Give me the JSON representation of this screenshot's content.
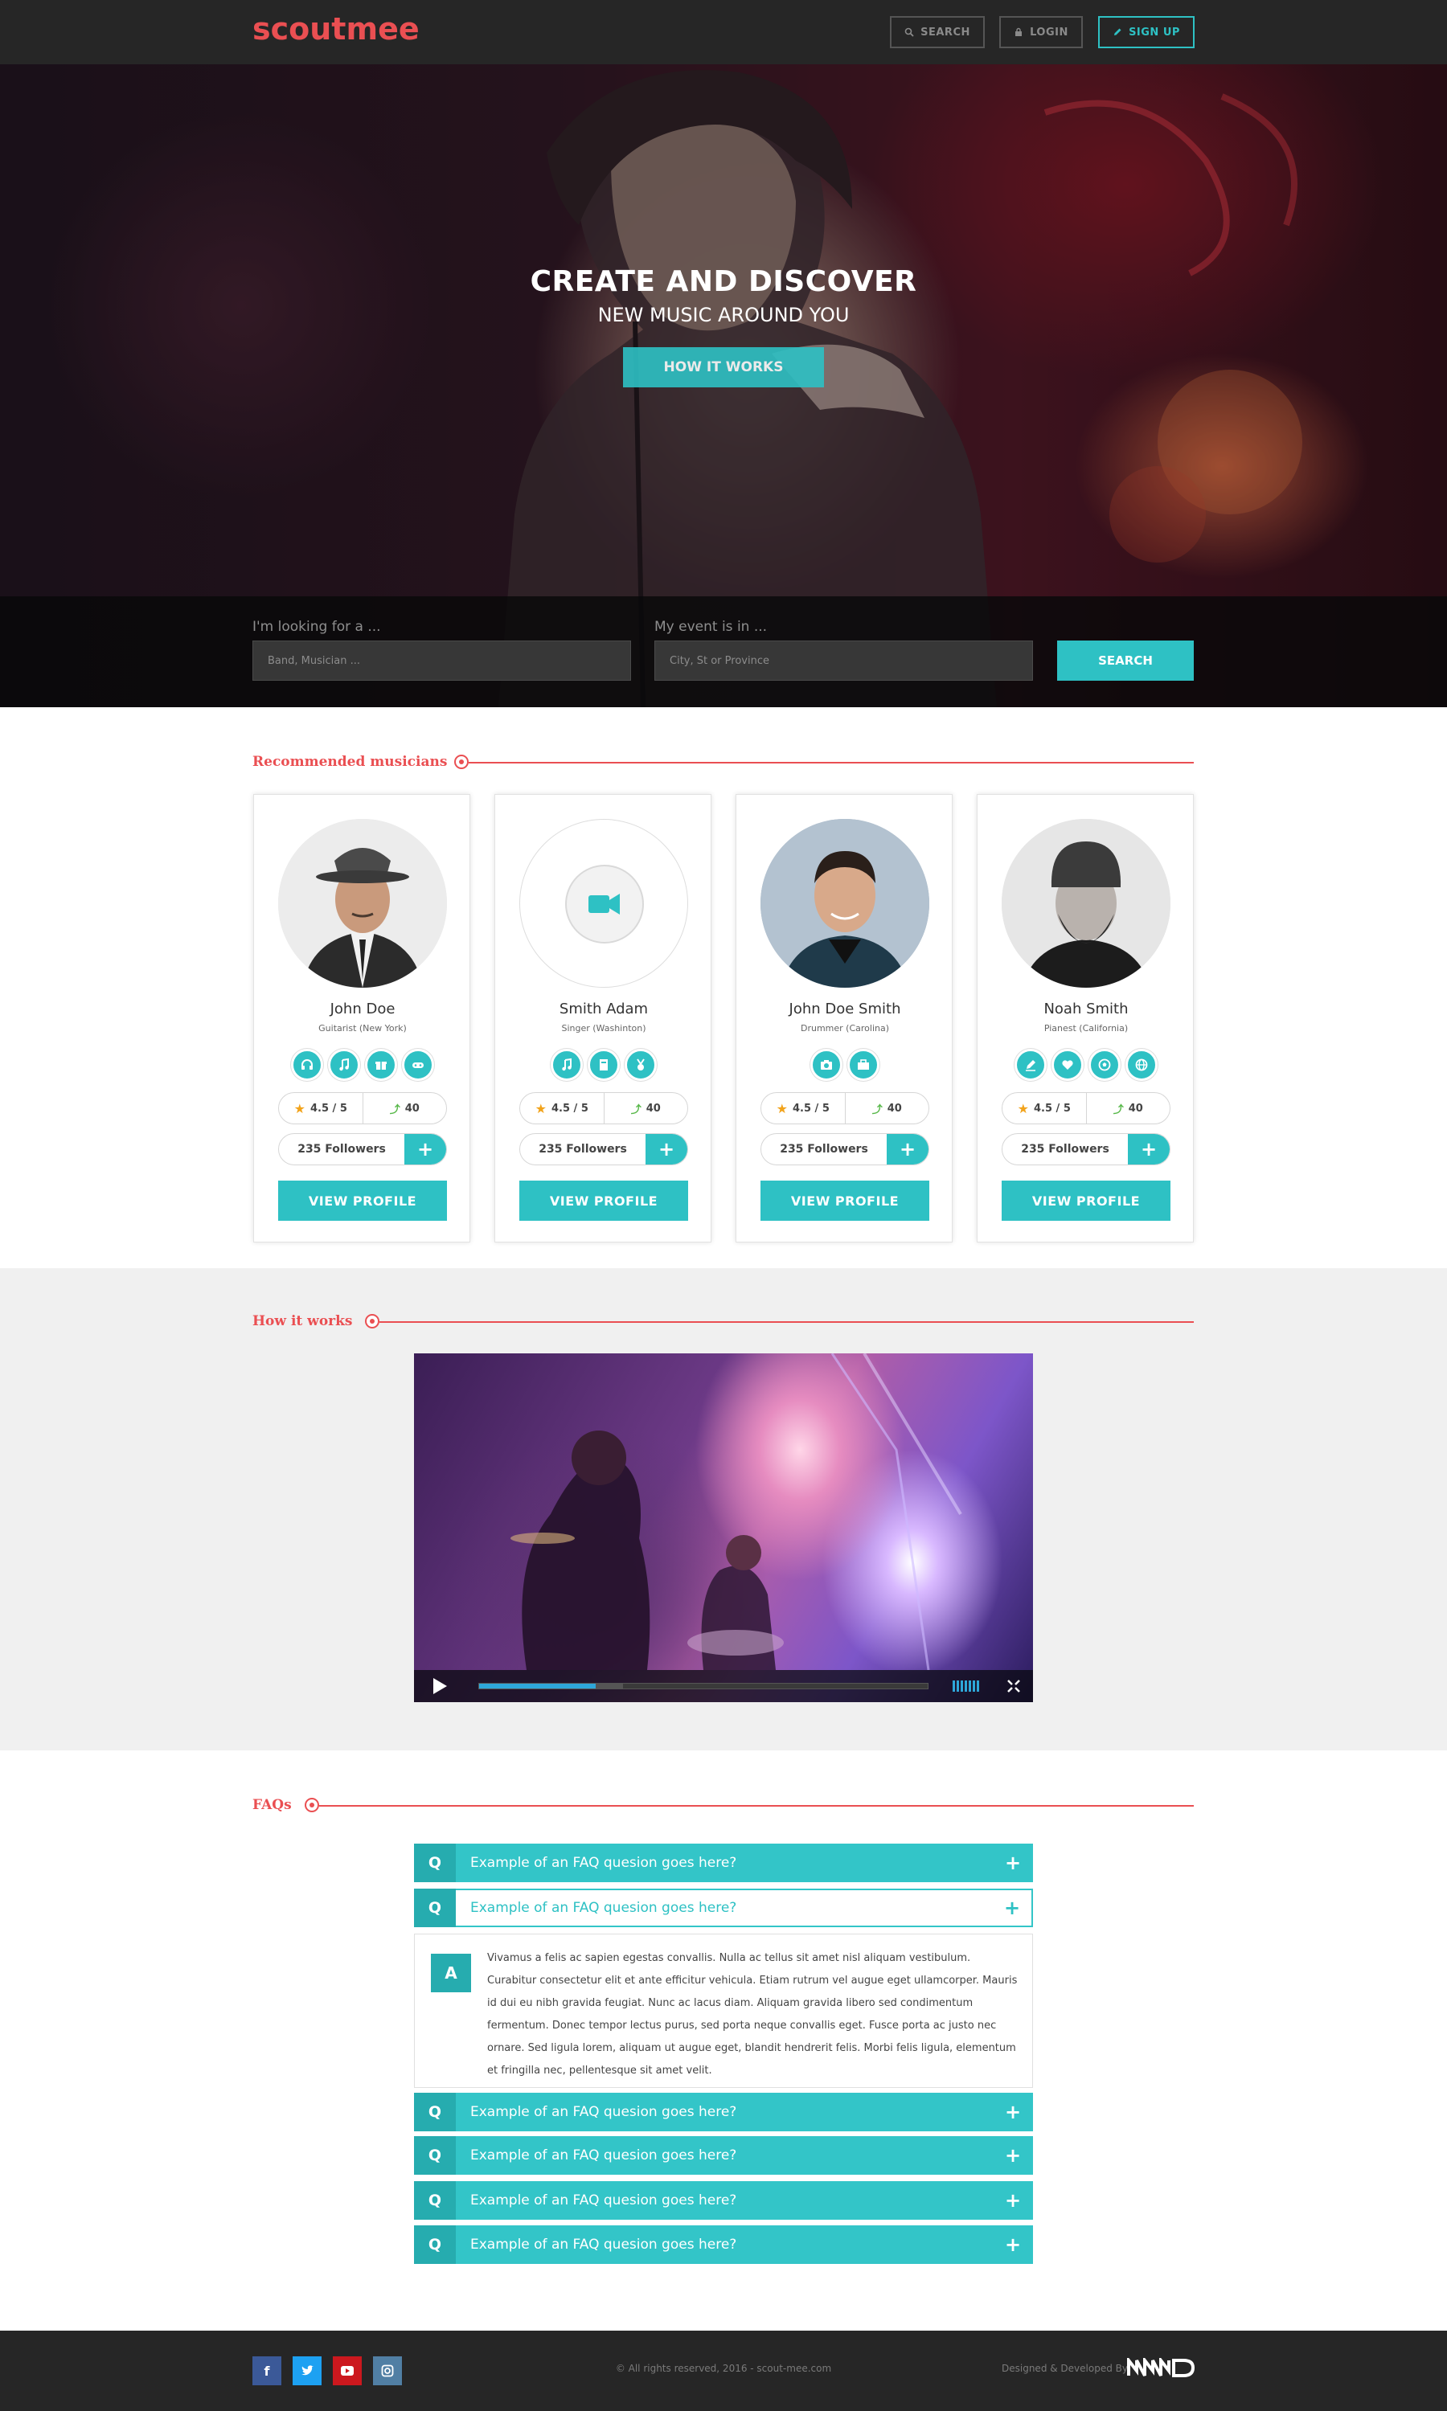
{
  "nav": {
    "logo": "scoutmee",
    "search_label": "SEARCH",
    "login_label": "LOGIN",
    "signup_label": "SIGN UP"
  },
  "hero": {
    "title": "CREATE AND DISCOVER",
    "subtitle": "NEW MUSIC AROUND YOU",
    "cta_label": "HOW IT WORKS",
    "search": {
      "looking_label": "I'm looking for a ...",
      "looking_placeholder": "Band, Musician ...",
      "event_label": "My event is in ...",
      "event_placeholder": "City, St or Province",
      "button_label": "SEARCH"
    }
  },
  "recommended": {
    "title": "Recommended musicians",
    "musicians": [
      {
        "name": "John Doe",
        "role": "Guitarist (New York)",
        "rating": "4.5 / 5",
        "score": "40",
        "followers": "235 Followers",
        "view_label": "VIEW PROFILE",
        "skills": [
          "headphones-icon",
          "music-note-icon",
          "gift-icon",
          "gamepad-icon"
        ]
      },
      {
        "name": "Smith Adam",
        "role": "Singer (Washinton)",
        "rating": "4.5 / 5",
        "score": "40",
        "followers": "235 Followers",
        "view_label": "VIEW PROFILE",
        "skills": [
          "music-note-icon",
          "book-icon",
          "medal-icon"
        ]
      },
      {
        "name": "John Doe Smith",
        "role": "Drummer (Carolina)",
        "rating": "4.5 / 5",
        "score": "40",
        "followers": "235 Followers",
        "view_label": "VIEW PROFILE",
        "skills": [
          "camera-icon",
          "briefcase-icon"
        ]
      },
      {
        "name": "Noah Smith",
        "role": "Pianest (California)",
        "rating": "4.5 / 5",
        "score": "40",
        "followers": "235 Followers",
        "view_label": "VIEW PROFILE",
        "skills": [
          "pen-icon",
          "heart-icon",
          "soccer-ball-icon",
          "globe-icon"
        ]
      }
    ]
  },
  "how": {
    "title": "How it works",
    "video_progress": 0.26
  },
  "faq": {
    "title": "FAQs",
    "q_letter": "Q",
    "a_letter": "A",
    "items": [
      {
        "question": "Example of an FAQ quesion goes here?"
      },
      {
        "question": "Example of an FAQ quesion goes here?"
      },
      {
        "question": "Example of an FAQ quesion goes here?"
      },
      {
        "question": "Example of an FAQ quesion goes here?"
      },
      {
        "question": "Example of an FAQ quesion goes here?"
      },
      {
        "question": "Example of an FAQ quesion goes here?"
      }
    ],
    "answer": "Vivamus a felis ac sapien egestas convallis. Nulla ac tellus sit amet nisl aliquam vestibulum. Curabitur consectetur elit et ante efficitur vehicula. Etiam rutrum vel augue eget ullamcorper. Mauris id dui eu nibh gravida feugiat. Nunc ac lacus diam. Aliquam gravida libero sed condimentum fermentum. Donec tempor lectus purus, sed porta neque convallis eget. Fusce porta ac justo nec ornare. Sed ligula lorem, aliquam ut augue eget, blandit hendrerit felis. Morbi felis ligula, elementum et fringilla nec, pellentesque sit amet velit."
  },
  "footer": {
    "copyright": "© All rights reserved, 2016 - scout-mee.com",
    "designed_by": "Designed & Developed By:",
    "social": [
      "facebook-icon",
      "twitter-icon",
      "youtube-icon",
      "instagram-icon"
    ]
  },
  "colors": {
    "accent": "#2ec1c4",
    "brand": "#ea4f52",
    "dark": "#262626"
  }
}
